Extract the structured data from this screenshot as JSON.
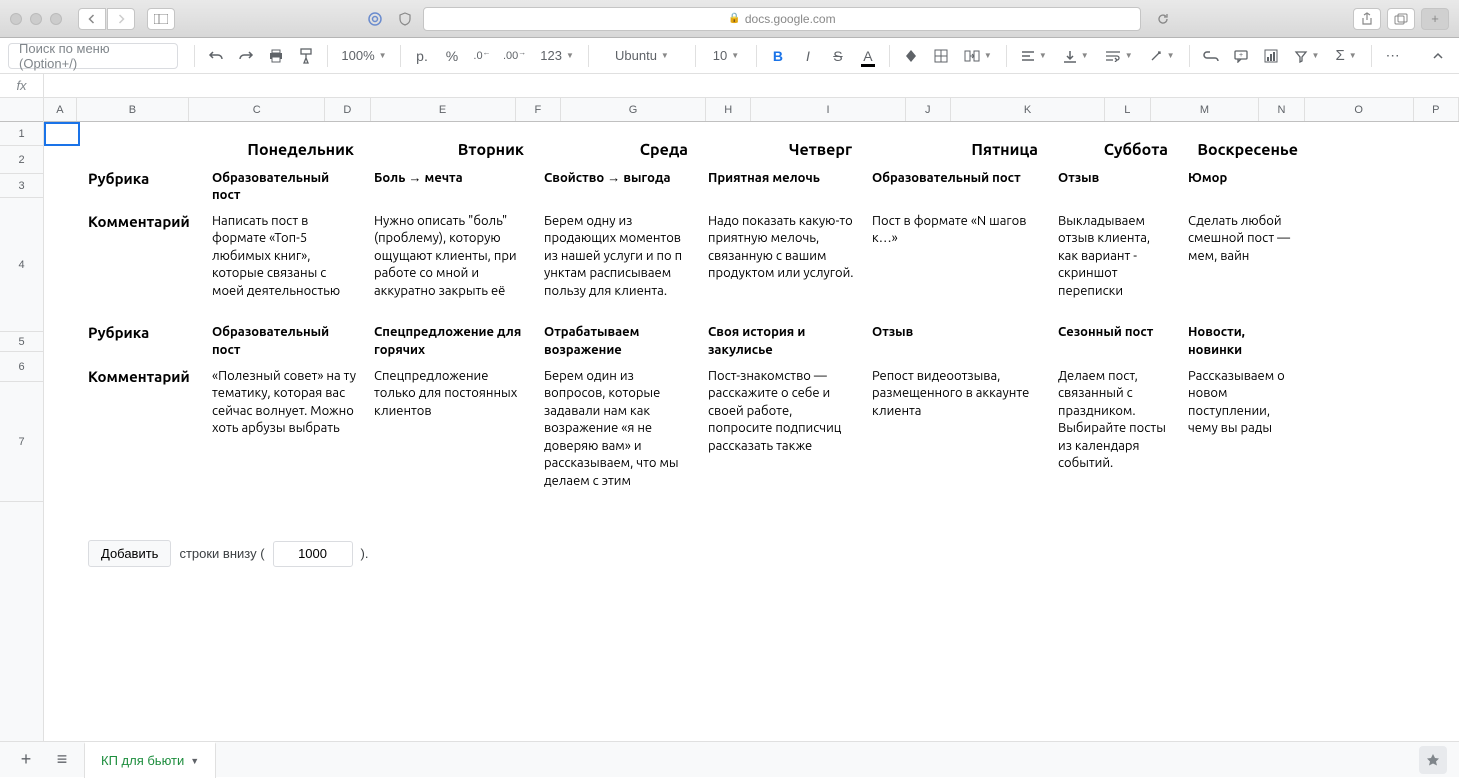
{
  "browser": {
    "url": "docs.google.com"
  },
  "toolbar": {
    "menu_search_placeholder": "Поиск по меню (Option+/)",
    "zoom": "100%",
    "currency_p": "р.",
    "currency_pct": "%",
    "dec_less": ".0",
    "dec_more": ".00",
    "num_fmt": "123",
    "font": "Ubuntu",
    "font_size": "10",
    "bold": "B",
    "italic": "I",
    "strike": "S",
    "text_color": "A"
  },
  "formula": {
    "fx": "fx"
  },
  "columns": [
    "A",
    "B",
    "C",
    "D",
    "E",
    "F",
    "G",
    "H",
    "I",
    "J",
    "K",
    "L",
    "M",
    "N",
    "O",
    "P"
  ],
  "rows": [
    "1",
    "2",
    "3",
    "4",
    "5",
    "6",
    "7"
  ],
  "days": [
    "Понедельник",
    "Вторник",
    "Среда",
    "Четверг",
    "Пятница",
    "Суббота",
    "Воскресенье"
  ],
  "labels": {
    "rubric": "Рубрика",
    "comment": "Комментарий"
  },
  "week1": {
    "rubrics": [
      "Образовательный пост",
      "Боль → мечта",
      "Свойство → выгода",
      "Приятная мелочь",
      "Образовательный пост",
      "Отзыв",
      "Юмор"
    ],
    "comments": [
      "Написать пост в формате «Топ-5 любимых книг», которые связаны с моей деятельностью",
      "Нужно описать \"боль\" (проблему), которую ощущают клиенты, при работе со мной и аккуратно закрыть её",
      "Берем одну из продающих моментов из нашей услуги и по п унктам расписываем пользу для клиента.",
      "Надо показать какую-то приятную мелочь, связанную с вашим продуктом или услугой.",
      "Пост в формате «N шагов к…»",
      "Выкладываем отзыв клиента, как вариант - скриншот переписки",
      "Сделать любой смешной пост — мем, вайн"
    ]
  },
  "week2": {
    "rubrics": [
      "Образовательный пост",
      "Спецпредложение для горячих",
      "Отрабатываем возражение",
      "Своя история и закулисье",
      "Отзыв",
      "Сезонный пост",
      "Новости, новинки"
    ],
    "comments": [
      "«Полезный совет» на ту тематику, которая вас сейчас волнует. Можно хоть арбузы выбрать",
      "Спецпредложение только для постоянных клиентов",
      "Берем один из вопросов, которые задавали нам как возражение «я не доверяю вам» и рассказываем, что мы делаем с этим",
      "Пост-знакомство — расскажите о себе и своей работе, попросите подписчиц рассказать также",
      "Репост видеоотзыва, размещенного в аккаунте клиента",
      "Делаем пост, связанный с праздником. Выбирайте посты из календаря событий.",
      "Рассказываем о новом поступлении, чему вы рады"
    ]
  },
  "add_rows": {
    "button": "Добавить",
    "before": "строки внизу (",
    "value": "1000",
    "after": ")."
  },
  "sheet": {
    "name": "КП для бьюти"
  }
}
